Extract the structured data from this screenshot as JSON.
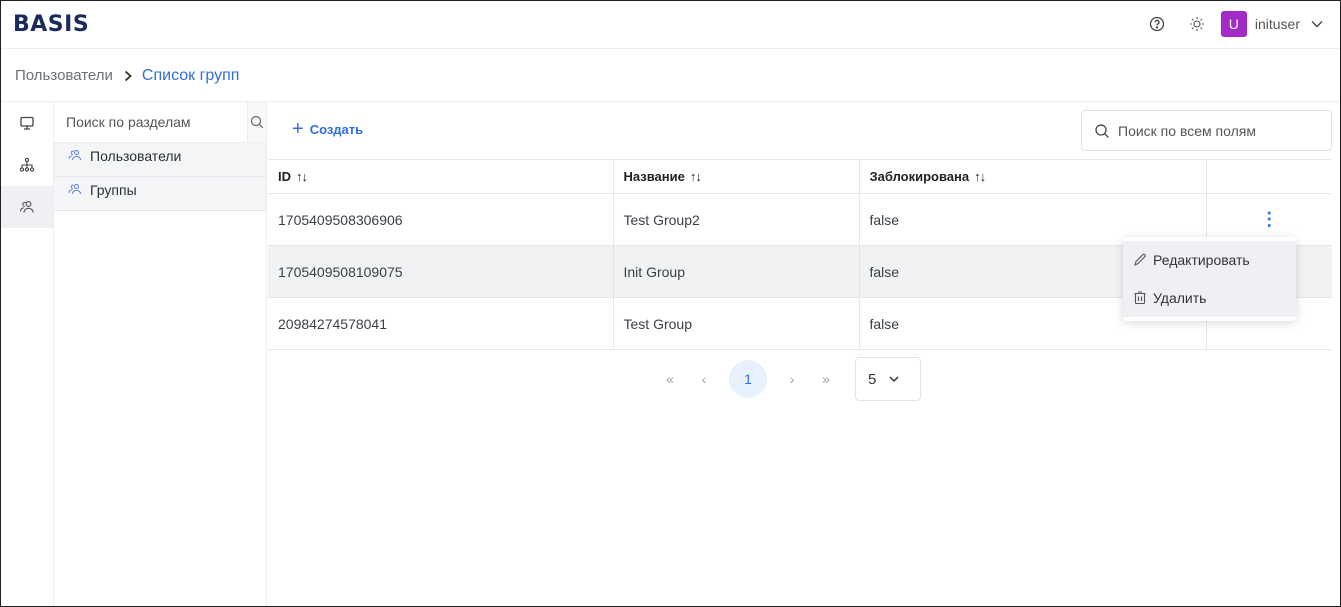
{
  "header": {
    "logo": "BASIS",
    "help_icon": "help-circle-icon",
    "theme_icon": "sun-icon",
    "avatar_letter": "U",
    "avatar_color": "#a32bc8",
    "username": "inituser"
  },
  "breadcrumb": {
    "parent": "Пользователи",
    "current": "Список групп"
  },
  "rail": {
    "items": [
      {
        "icon": "monitor-icon",
        "active": false
      },
      {
        "icon": "hierarchy-icon",
        "active": false
      },
      {
        "icon": "users-icon",
        "active": true
      }
    ]
  },
  "sections": {
    "search_placeholder": "Поиск по разделам",
    "items": [
      {
        "label": "Пользователи",
        "icon": "users-icon"
      },
      {
        "label": "Группы",
        "icon": "users-icon"
      }
    ]
  },
  "toolbar": {
    "create_label": "Создать",
    "search_placeholder": "Поиск по всем полям"
  },
  "table": {
    "columns": [
      {
        "label": "ID",
        "sort": "↑↓"
      },
      {
        "label": "Название",
        "sort": "↑↓"
      },
      {
        "label": "Заблокирована",
        "sort": "↑↓"
      }
    ],
    "rows": [
      {
        "id": "1705409508306906",
        "name": "Test Group2",
        "blocked": "false"
      },
      {
        "id": "1705409508109075",
        "name": "Init Group",
        "blocked": "false"
      },
      {
        "id": "20984274578041",
        "name": "Test Group",
        "blocked": "false"
      }
    ],
    "actions_icon": "⋮"
  },
  "pagination": {
    "first": "«",
    "prev": "‹",
    "current_page": "1",
    "next": "›",
    "last": "»",
    "page_size": "5"
  },
  "context_menu": {
    "items": [
      {
        "label": "Редактировать",
        "icon": "pencil-icon"
      },
      {
        "label": "Удалить",
        "icon": "trash-icon"
      }
    ]
  },
  "colors": {
    "accent": "#2f6fe0",
    "logo": "#1b2a5e",
    "highlight_row": "#f1f2f4"
  }
}
